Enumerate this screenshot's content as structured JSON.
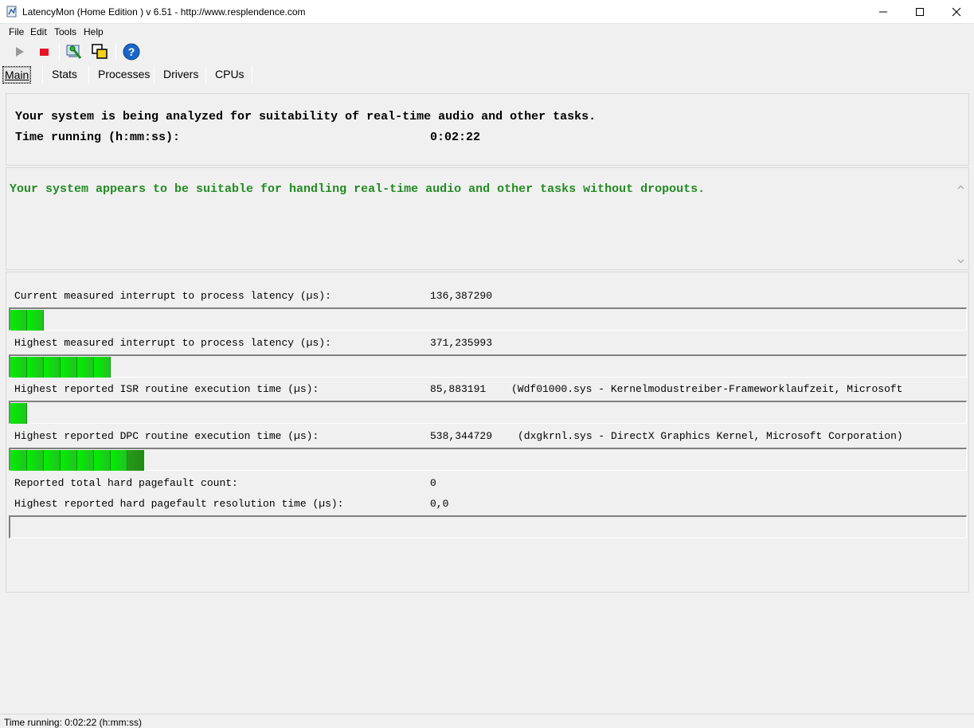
{
  "window": {
    "title": "LatencyMon  (Home Edition )  v 6.51 - http://www.resplendence.com"
  },
  "menu": {
    "file": "File",
    "edit": "Edit",
    "tools": "Tools",
    "help": "Help"
  },
  "toolbar": {
    "icons": [
      "play-icon",
      "stop-icon",
      "analyze-icon",
      "windows-icon",
      "help-icon"
    ]
  },
  "tabs": [
    "Main",
    "Stats",
    "Processes",
    "Drivers",
    "CPUs"
  ],
  "main": {
    "analysis_line": "Your system is being analyzed for suitability of real-time audio and other tasks.",
    "time_label": "Time running (h:mm:ss):",
    "time_value": "0:02:22",
    "conclusion": "Your system appears to be suitable for handling real-time audio and other tasks without dropouts.",
    "conclusion_color": "#228b22",
    "metrics": [
      {
        "label": "Current measured interrupt to process latency (µs):",
        "value": "136,387290",
        "extra": "",
        "bar_segments": 2
      },
      {
        "label": "Highest measured interrupt to process latency (µs):",
        "value": "371,235993",
        "extra": "",
        "bar_segments": 6
      },
      {
        "label": "Highest reported ISR routine execution time (µs):",
        "value": "85,883191",
        "extra": "(Wdf01000.sys - Kernelmodustreiber-Frameworklaufzeit, Microsoft",
        "bar_segments": 1
      },
      {
        "label": "Highest reported DPC routine execution time (µs):",
        "value": "538,344729",
        "extra": "(dxgkrnl.sys - DirectX Graphics Kernel, Microsoft Corporation)",
        "bar_segments": 8
      }
    ],
    "pagefault_count_label": "Reported total hard pagefault count:",
    "pagefault_count_value": "0",
    "pagefault_time_label": "Highest reported hard pagefault resolution time (µs):",
    "pagefault_time_value": "0,0",
    "pagefault_bar_segments": 0
  },
  "status": {
    "text": "Time running: 0:02:22  (h:mm:ss)"
  },
  "colors": {
    "bar_green": "#00f000",
    "stop_red": "#e81123"
  }
}
